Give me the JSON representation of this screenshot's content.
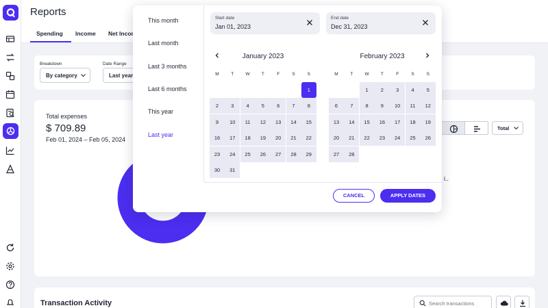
{
  "header": {
    "title": "Reports",
    "tabs": [
      {
        "label": "Spending",
        "active": true
      },
      {
        "label": "Income",
        "active": false
      },
      {
        "label": "Net Income",
        "active": false
      }
    ]
  },
  "rail": {
    "icons": [
      "logo-icon",
      "accounts-icon",
      "transfers-icon",
      "categories-icon",
      "calendar-icon",
      "reports-list-icon",
      "reports-pie-icon",
      "trends-icon",
      "investments-icon",
      "refresh-icon",
      "settings-icon",
      "help-icon",
      "notifications-icon"
    ],
    "active": "reports-pie-icon"
  },
  "filters": {
    "breakdown_label": "Breakdown",
    "breakdown_value": "By category",
    "date_range_label": "Date Range",
    "date_range_value": "Last year"
  },
  "summary": {
    "total_label": "Total expenses",
    "total_value": "$ 709.89",
    "date_range": "Feb 01, 2024 – Feb 05, 2024",
    "total_select": "Total",
    "truncated_label": "i..",
    "donut_fill_percent": 100
  },
  "transactions": {
    "title": "Transaction Activity",
    "search_placeholder": "Search transactions"
  },
  "picker": {
    "presets": [
      "This month",
      "Last month",
      "Last 3 months",
      "Last 6 months",
      "This year",
      "Last year"
    ],
    "selected_preset": "Last year",
    "start_label": "Start date",
    "start_value": "Jan 01, 2023",
    "end_label": "End date",
    "end_value": "Dec 31, 2023",
    "weekdays": [
      "M",
      "T",
      "W",
      "T",
      "F",
      "S",
      "S"
    ],
    "months": [
      {
        "title": "January 2023",
        "first_weekday_index": 6,
        "days": 31,
        "selected_day": 1
      },
      {
        "title": "February 2023",
        "first_weekday_index": 2,
        "days": 28,
        "selected_day": null
      }
    ],
    "cancel_label": "CANCEL",
    "apply_label": "APPLY DATES"
  },
  "colors": {
    "accent": "#4b2ef0",
    "range_fill": "#e8e9f3",
    "background": "#f1f2f6"
  }
}
